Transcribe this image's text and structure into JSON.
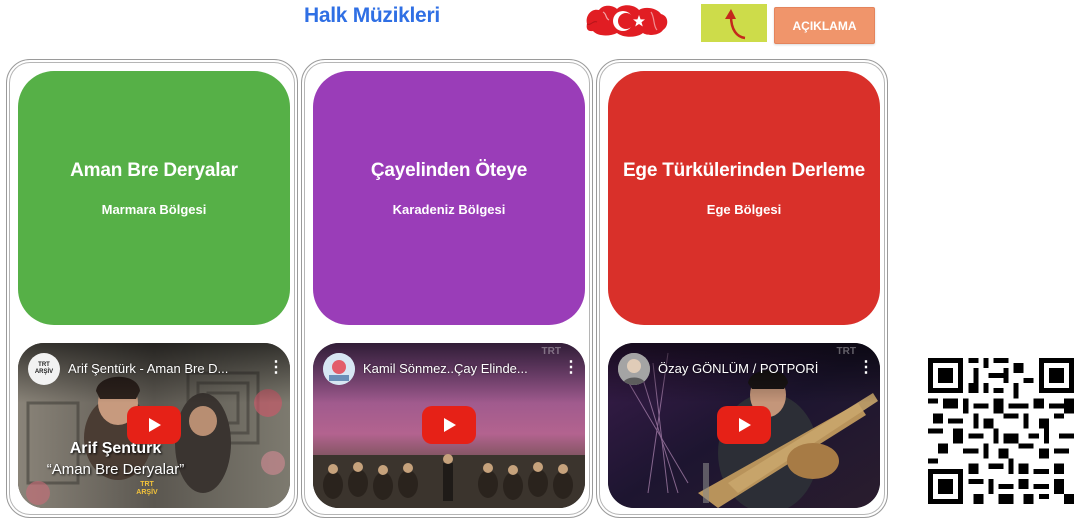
{
  "header": {
    "title": "Halk Müzikleri",
    "aciklama_label": "AÇIKLAMA",
    "flag_icon": "turkey-flag-icon",
    "back_icon": "curved-arrow-up-icon"
  },
  "colors": {
    "title_blue": "#2f6fe4",
    "card_green": "#56b047",
    "card_purple": "#9a3db8",
    "card_red": "#d9302a",
    "back_button": "#cddc4a",
    "aciklama_button": "#f0956b",
    "play_red": "#e62117"
  },
  "cards": [
    {
      "title": "Aman Bre Deryalar",
      "region": "Marmara Bölgesi",
      "video": {
        "title": "Arif Şentürk - Aman Bre D...",
        "overlay_name": "Arif Şentürk",
        "overlay_song": "“Aman Bre Deryalar”",
        "overlay_logo": "TRT ARŞİV",
        "channel_avatar": "TRT ARŞİV"
      }
    },
    {
      "title": "Çayelinden Öteye",
      "region": "Karadeniz Bölgesi",
      "video": {
        "title": "Kamil Sönmez..Çay Elinde...",
        "watermark": "TRT"
      }
    },
    {
      "title": "Ege Türkülerinden Derleme",
      "region": "Ege Bölgesi",
      "video": {
        "title": "Özay GÖNLÜM / POTPORİ",
        "watermark": "TRT"
      }
    }
  ],
  "qr_icon": "qr-code-icon"
}
